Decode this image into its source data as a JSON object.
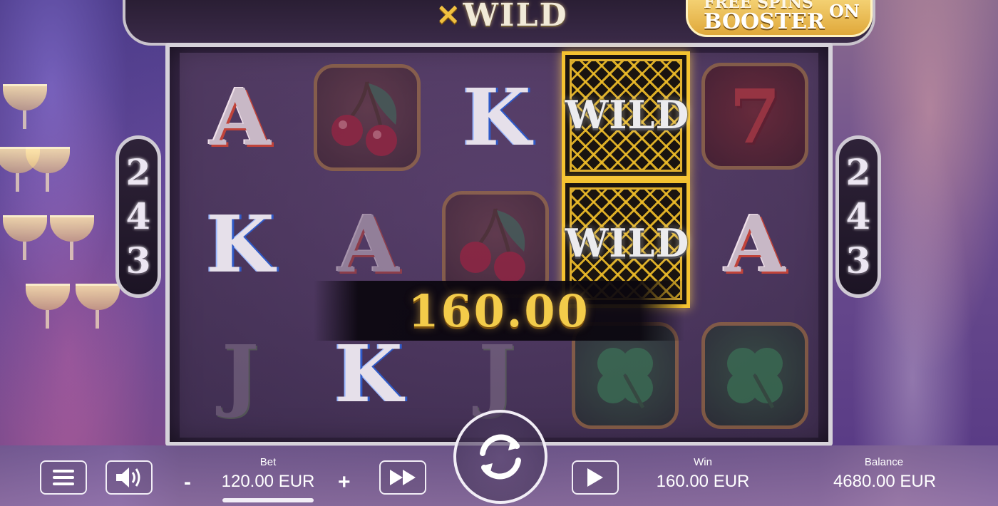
{
  "game": {
    "logo_text": "WILD",
    "logo_mark": "✕",
    "booster_line1": "FREE SPINS",
    "booster_line2": "BOOSTER",
    "booster_state": "ON",
    "ways_left": [
      "2",
      "4",
      "3"
    ],
    "ways_right": [
      "2",
      "4",
      "3"
    ],
    "wild_label": "WILD",
    "win_amount": "160.00"
  },
  "reels": {
    "symbols": [
      [
        "A",
        "K",
        "J"
      ],
      [
        "cherry",
        "A",
        "K"
      ],
      [
        "K",
        "cherry",
        "J"
      ],
      [
        "wild",
        "wild",
        "clover"
      ],
      [
        "seven",
        "A",
        "clover"
      ]
    ]
  },
  "controls": {
    "menu_icon": "hamburger-icon",
    "sound_icon": "speaker-icon",
    "bet_label": "Bet",
    "bet_value": "120.00 EUR",
    "bet_minus": "-",
    "bet_plus": "+",
    "turbo_icon": "fast-forward-icon",
    "spin_icon": "refresh-icon",
    "autoplay_icon": "play-icon",
    "win_label": "Win",
    "win_value": "160.00 EUR",
    "balance_label": "Balance",
    "balance_value": "4680.00 EUR"
  },
  "colors": {
    "gold": "#f3cc4a",
    "frame": "#d6d2da",
    "wild_border": "#f4c230"
  }
}
